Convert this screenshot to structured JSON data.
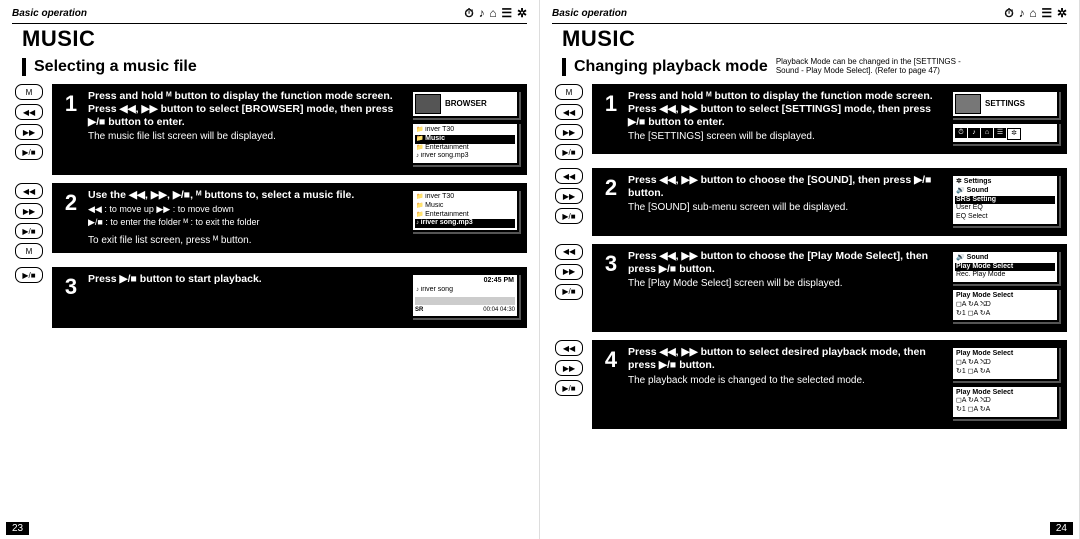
{
  "left": {
    "breadcrumb": "Basic operation",
    "title": "MUSIC",
    "subhead": "Selecting a music file",
    "steps": [
      {
        "num": "1",
        "buttons": [
          "M",
          "◀◀",
          "▶▶",
          "▶/■"
        ],
        "bold1": "Press and hold ᴹ button to display the function mode screen.",
        "bold2": "Press ◀◀, ▶▶ button to select [BROWSER] mode, then press ▶/■ button to enter.",
        "sub": "The music file list screen will be displayed.",
        "screen_head": "BROWSER",
        "screen_rows": [
          {
            "t": "iriver T30",
            "k": "folder",
            "hi": false
          },
          {
            "t": "Music",
            "k": "folder",
            "hi": true
          },
          {
            "t": "Entertainment",
            "k": "folder",
            "hi": false
          },
          {
            "t": "iriver song.mp3",
            "k": "file",
            "hi": false
          }
        ]
      },
      {
        "num": "2",
        "buttons": [
          "◀◀",
          "▶▶",
          "▶/■",
          "M"
        ],
        "bold1": "Use the ◀◀, ▶▶, ▶/■, ᴹ buttons to, select a music file.",
        "hint_a": "◀◀ : to move up      ▶▶ : to move down",
        "hint_b": "▶/■ : to enter the folder   ᴹ : to exit the folder",
        "sub": "To exit file list screen, press ᴹ button.",
        "screen_rows": [
          {
            "t": "iriver T30",
            "k": "folder",
            "hi": false
          },
          {
            "t": "Music",
            "k": "folder",
            "hi": false
          },
          {
            "t": "Entertainment",
            "k": "folder",
            "hi": false
          },
          {
            "t": "iriver song.mp3",
            "k": "file",
            "hi": true
          }
        ]
      },
      {
        "num": "3",
        "buttons": [
          "▶/■"
        ],
        "bold1": "Press ▶/■ button to start playback.",
        "screen_time_top": "02:45 PM",
        "screen_song": "iriver song",
        "screen_time": "00:04 04:30",
        "screen_sr": "SR"
      }
    ],
    "pagenum": "23"
  },
  "right": {
    "breadcrumb": "Basic operation",
    "title": "MUSIC",
    "subhead": "Changing playback mode",
    "subnote": "Playback Mode can be changed in the [SETTINGS - Sound - Play Mode Select]. (Refer to page 47)",
    "steps": [
      {
        "num": "1",
        "buttons": [
          "M",
          "◀◀",
          "▶▶",
          "▶/■"
        ],
        "bold1": "Press and hold ᴹ button to display the function mode screen.",
        "bold2": "Press ◀◀, ▶▶ button to select [SETTINGS] mode, then press ▶/■ button to enter.",
        "sub": "The [SETTINGS] screen will be displayed.",
        "screen_head": "SETTINGS",
        "screen_icons": [
          "⏱",
          "♪",
          "⌂",
          "☰",
          "✲"
        ]
      },
      {
        "num": "2",
        "buttons": [
          "◀◀",
          "▶▶",
          "▶/■"
        ],
        "bold1": "Press ◀◀, ▶▶ button to choose the [SOUND], then press ▶/■ button.",
        "sub": "The [SOUND] sub-menu screen will be displayed.",
        "screen_title": "✲ Settings",
        "screen_sub": "🔊 Sound",
        "screen_rows": [
          {
            "t": "SRS Setting",
            "hi": true
          },
          {
            "t": "User EQ",
            "hi": false
          },
          {
            "t": "EQ Select",
            "hi": false
          }
        ]
      },
      {
        "num": "3",
        "buttons": [
          "◀◀",
          "▶▶",
          "▶/■"
        ],
        "bold1": "Press ◀◀, ▶▶ button to choose the [Play Mode Select], then press ▶/■ button.",
        "sub": "The [Play Mode Select] screen will be displayed.",
        "screen_sub": "🔊 Sound",
        "screen_rows": [
          {
            "t": "Play Mode Select",
            "hi": true
          },
          {
            "t": "Rec. Play Mode",
            "hi": false
          }
        ],
        "pm_title": "Play Mode Select",
        "pm_rows": [
          "◻A  ↻A  ⤭D",
          "↻1  ◻A  ↻A"
        ]
      },
      {
        "num": "4",
        "buttons": [
          "◀◀",
          "▶▶",
          "▶/■"
        ],
        "bold1": "Press ◀◀, ▶▶ button to select desired playback mode, then press ▶/■ button.",
        "sub": "The playback mode is changed to the selected mode.",
        "pm_title": "Play Mode Select",
        "pm_rows_a": [
          "◻A  ↻A  ⤭D",
          "↻1  ◻A  ↻A"
        ],
        "pm_rows_b": [
          "◻A  ↻A  ⤭D",
          "↻1  ◻A  ↻A"
        ]
      }
    ],
    "pagenum": "24"
  },
  "top_icons": [
    "⏱",
    "♪",
    "⌂",
    "☰",
    "✲"
  ]
}
